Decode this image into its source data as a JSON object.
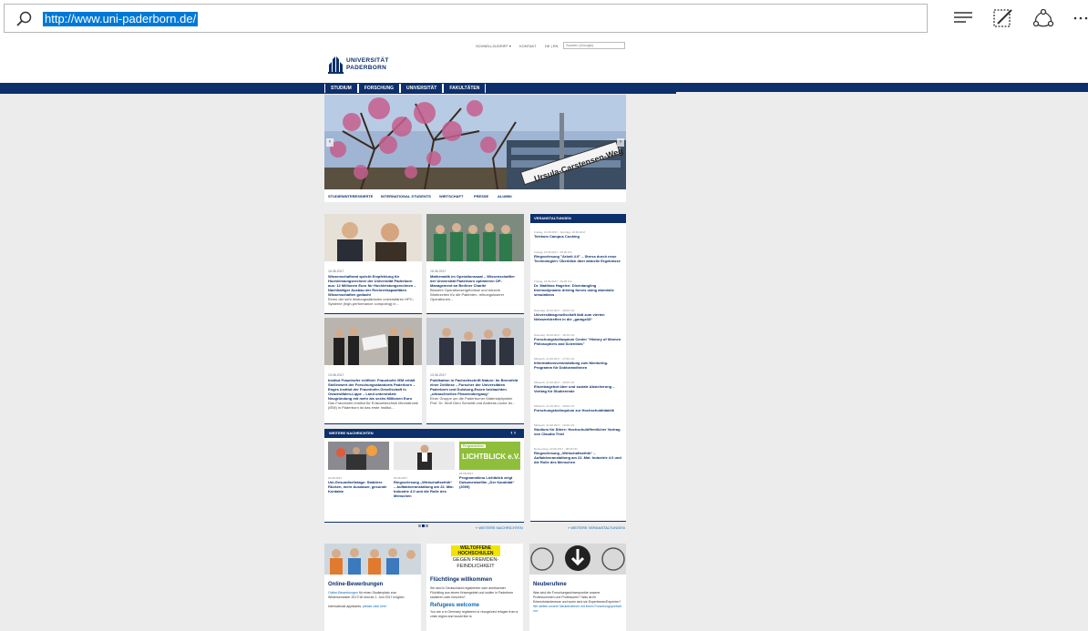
{
  "browser": {
    "url": "http://www.uni-paderborn.de/",
    "icons": [
      "search-icon",
      "hub-icon",
      "web-note-icon",
      "share-icon",
      "more-icon"
    ]
  },
  "site": {
    "toplinks": [
      "SCHNELLZUGRIFF ▾",
      "KONTAKT",
      "DE | EN"
    ],
    "search_placeholder": "Suchen (Google)",
    "logo_line1": "UNIVERSITÄT",
    "logo_line2": "PADERBORN",
    "mainnav": [
      "STUDIUM",
      "FORSCHUNG",
      "UNIVERSITÄT",
      "FAKULTÄTEN"
    ],
    "subnav": [
      "STUDIENINTERESSIERTE",
      "INTERNATIONAL STUDENTS",
      "WIRTSCHAFT",
      "PRESSE",
      "ALUMNI"
    ],
    "hero_sign": "Ursula-Carstensen-Weg"
  },
  "news": [
    {
      "date": "16.06.2017",
      "headline": "Wissenschaftsrat spricht Empfehlung für Hochleistungsrechner der Universität Paderborn aus: 12 Millionen Euro für Hochleistungsrechnen – Nachhaltiger Ausbau der Rechnerkapazitäten Wissenschaften gedacht",
      "text": "Einen der sehr leistungsstärksten universitären HPC-Systeme (high-performance computing) in..."
    },
    {
      "date": "16.06.2017",
      "headline": "Mathematik im Operationssaal – Wissenschaftler der Universität Paderborn optimieren OP-Management an Berliner Charité",
      "text": "Bessere Operationsergebnisse und kürzere Wartezeiten für die Patienten, reibungsloserer Operationen..."
    },
    {
      "date": "13.06.2017",
      "headline": "Institut Fraunhofer eröffnet: Fraunhofer IEM erhält Stellenwert der Forschungsstandorts Paderborn – Enges Institut der Fraunhofer-Gesellschaft in Ostwestfalen-Lippe – Land unterstützte Neugründung mit mehr als sechs Millionen Euro",
      "text": "Das Fraunhofer-Institut für Entwurfstechnik Mechatronik (IEM) in Paderborn ist das erste Institut..."
    },
    {
      "date": "13.06.2017",
      "headline": "Publikation in Fachzeitschrift Nature: Im Brennfeld einer Zeitlinse – Forscher der Universitäten Paderborn und Duisburg-Essen beobachten „ultraschnellen Phasenübergang“",
      "text": "Einer Gruppe um die Paderborner Materialphysiker Prof. Dr. Wolf Gero Schmidt und Andreas Lücke ist..."
    }
  ],
  "events": {
    "heading": "VERANSTALTUNGEN",
    "items": [
      {
        "date": "Freitag, 16.06.2017 - Sonntag, 18.06.2017",
        "title": "Telekom Campus Cooking"
      },
      {
        "date": "Freitag, 16.06.2017 - 09:30 Uhr",
        "title": "Ringvorlesung \"Arbeit 4.0\" – Stress durch neue Technologien: Überblick über aktuelle Ergebnisse"
      },
      {
        "date": "Freitag, 16.06.2017 - 09:45 Uhr",
        "title": "Dr. Matthias Hagelen: Disentangling thermodynamic driving forces using atomistic simulations"
      },
      {
        "date": "Dienstag, 20.06.2017 - 18:00 Uhr",
        "title": "Universitätsgesellschaft lädt zum vierten Netzwerktreffen in die „garage33“"
      },
      {
        "date": "Dienstag, 20.06.2017 - 18:15 Uhr",
        "title": "Forschungskolloquium Center \"History of Women Philosophers and Scientists\""
      },
      {
        "date": "Mittwoch, 21.06.2017 - 17:00 Uhr",
        "title": "Informationsveranstaltung zum Mentoring-Programm für Doktorandinnen"
      },
      {
        "date": "Mittwoch, 21.06.2017 - 18:00 Uhr",
        "title": "Einzelangebot über und soziale Absicherung – Vortrag für Studierende"
      },
      {
        "date": "Mittwoch, 21.06.2017 - 18:00 Uhr",
        "title": "Forschungskolloquium zur Hochschuldidaktik"
      },
      {
        "date": "Mittwoch, 21.06.2017 - 19:00 Uhr",
        "title": "Studium für Ältere: Hochschulöffentlicher Vortrag von Claudia Thiel"
      },
      {
        "date": "Donnerstag, 22.06.2017 - 08:30 Uhr",
        "title": "Ringvorlesung „Wirtschaftsethik“ – Auftaktveranstaltung am 22. Mai: Industrie 4.0 und die Rolle des Menschen"
      }
    ],
    "more": "» WEITERE VERANSTALTUNGEN"
  },
  "weitere": {
    "heading": "WEITERE NACHRICHTEN",
    "items": [
      {
        "date": "16.06.2017",
        "title": "Uni-Gesundheitstage: Stabilere Rücken, mehr Ausdauer, gesunde Kontakte"
      },
      {
        "date": "15.06.2017",
        "title": "Ringvorlesung „Wirtschaftsethik“ – Auftaktveranstaltung am 22. Mai: Industrie 4.0 und die Rolle des Menschen"
      },
      {
        "date": "15.06.2017",
        "title": "Programmkino Lichtblick zeigt Dokumentarfilm „Der Kandidat“ (2009)"
      }
    ],
    "lichtblick_top": "Programmkino",
    "lichtblick": "LICHTBLICK e.V.",
    "more": "» WEITERE NACHRICHTEN"
  },
  "bottom": [
    {
      "title": "Online-Bewerbungen",
      "p1_link": "Online-Bewerbungen",
      "p1": " für einen Studienplatz zum Wintersemester 2017/18 sind ab 1. Juni 2017 möglich.",
      "p2": "International applicants: ",
      "p2_link": "please click here"
    },
    {
      "title": "Flüchtlinge willkommen",
      "p1": "Sie sind in Deutschland registrierter oder anerkannter Flüchtling aus einem Krisengebiet und wollen in Paderborn studieren oder forschen?",
      "title2": "Refugees welcome",
      "p2": "You are a in Germany registered or recognized refugee from a crisis region and would like to",
      "banner1": "WELTOFFENE",
      "banner2": "HOCHSCHULEN",
      "banner3": "GEGEN FREMDEN-",
      "banner4": "FEINDLICHKEIT"
    },
    {
      "title": "Neuberufene",
      "p1": "Was sind die Forschungsschwerpunkte unserer Professorinnen und Professoren? Was ist ihr Erkenntnisinteresse und worin sind sie Expertinnen/Experten? ",
      "p1_link": "Wir stellen unsere Neuberufenen mit ihrem Forschungsportrait vor."
    }
  ]
}
